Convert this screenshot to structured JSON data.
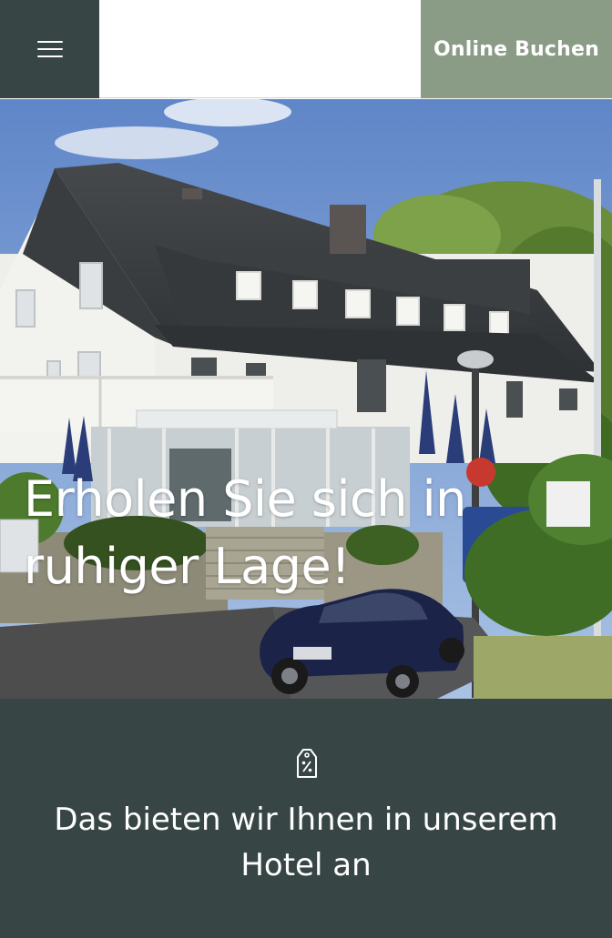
{
  "header": {
    "menu_icon": "hamburger-menu-icon",
    "book_label": "Online Buchen"
  },
  "hero": {
    "title": "Erholen Sie sich in ruhiger Lage!",
    "image_description": "hotel-building-photo"
  },
  "offers": {
    "icon": "price-tag-percent-icon",
    "title": "Das bieten wir Ihnen in unserem Hotel an"
  },
  "colors": {
    "dark_teal": "#374645",
    "sage_green": "#8a9b86",
    "white": "#ffffff"
  }
}
